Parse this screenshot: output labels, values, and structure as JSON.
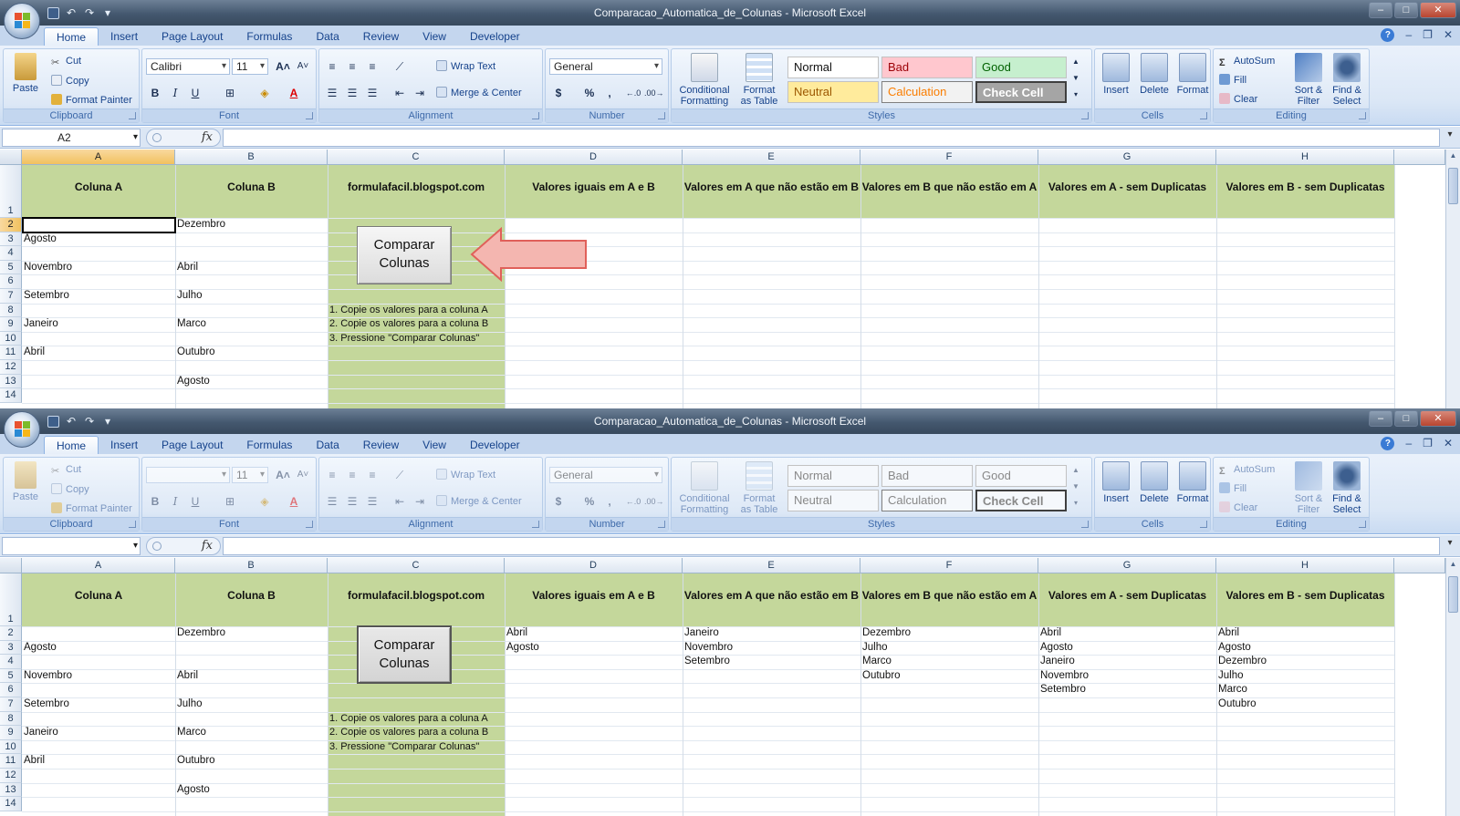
{
  "window_title": "Comparacao_Automatica_de_Colunas - Microsoft Excel",
  "tabs": [
    "Home",
    "Insert",
    "Page Layout",
    "Formulas",
    "Data",
    "Review",
    "View",
    "Developer"
  ],
  "clipboard": {
    "paste": "Paste",
    "cut": "Cut",
    "copy": "Copy",
    "format_painter": "Format Painter",
    "label": "Clipboard"
  },
  "font": {
    "family": "Calibri",
    "size": "11",
    "label": "Font"
  },
  "alignment": {
    "wrap_text": "Wrap Text",
    "merge_center": "Merge & Center",
    "label": "Alignment"
  },
  "number": {
    "format": "General",
    "label": "Number"
  },
  "styles": {
    "conditional_formatting": [
      "Conditional",
      "Formatting"
    ],
    "format_as_table": [
      "Format",
      "as Table"
    ],
    "normal": "Normal",
    "bad": "Bad",
    "good": "Good",
    "neutral": "Neutral",
    "calculation": "Calculation",
    "check_cell": "Check Cell",
    "label": "Styles"
  },
  "cells_group": {
    "insert": "Insert",
    "delete": "Delete",
    "format": "Format",
    "label": "Cells"
  },
  "editing": {
    "autosum": "AutoSum",
    "fill": "Fill",
    "clear": "Clear",
    "sort_filter": [
      "Sort &",
      "Filter"
    ],
    "find_select": [
      "Find &",
      "Select"
    ],
    "label": "Editing"
  },
  "name_box_top": "A2",
  "name_box_bottom": "",
  "fx": "fx",
  "columns": [
    "A",
    "B",
    "C",
    "D",
    "E",
    "F",
    "G",
    "H"
  ],
  "rows": [
    "1",
    "2",
    "3",
    "4",
    "5",
    "6",
    "7",
    "8",
    "9",
    "10",
    "11",
    "12",
    "13",
    "14"
  ],
  "headers": [
    "Coluna A",
    "Coluna B",
    "formulafacil.blogspot.com",
    "Valores iguais em A e B",
    "Valores em A que não estão em B",
    "Valores em B que não estão em A",
    "Valores em A - sem Duplicatas",
    "Valores em B - sem Duplicatas"
  ],
  "button_label": [
    "Comparar",
    "Colunas"
  ],
  "instructions": [
    "1. Copie os valores para a coluna A",
    "2. Copie os valores para a coluna B",
    "3. Pressione \"Comparar Colunas\""
  ],
  "col_a": [
    "",
    "Agosto",
    "",
    "Novembro",
    "",
    "Setembro",
    "",
    "Janeiro",
    "",
    "Abril",
    "",
    "",
    ""
  ],
  "col_b": [
    "Dezembro",
    "",
    "",
    "Abril",
    "",
    "Julho",
    "",
    "Marco",
    "",
    "Outubro",
    "",
    "Agosto",
    ""
  ],
  "results": {
    "d": [
      "Abril",
      "Agosto"
    ],
    "e": [
      "Janeiro",
      "Novembro",
      "Setembro"
    ],
    "f": [
      "Dezembro",
      "Julho",
      "Marco",
      "Outubro"
    ],
    "g": [
      "Abril",
      "Agosto",
      "Janeiro",
      "Novembro",
      "Setembro"
    ],
    "h": [
      "Abril",
      "Agosto",
      "Dezembro",
      "Julho",
      "Marco",
      "Outubro"
    ]
  },
  "colors": {
    "green_band": "#c4d79b",
    "arrow_fill": "#f4b6b0",
    "arrow_stroke": "#e0605a",
    "bad_bg": "#ffc7ce",
    "good_bg": "#c6efce",
    "neutral_bg": "#ffeb9c",
    "calc_bg": "#f2f2f2",
    "check_bg": "#a5a5a5"
  }
}
